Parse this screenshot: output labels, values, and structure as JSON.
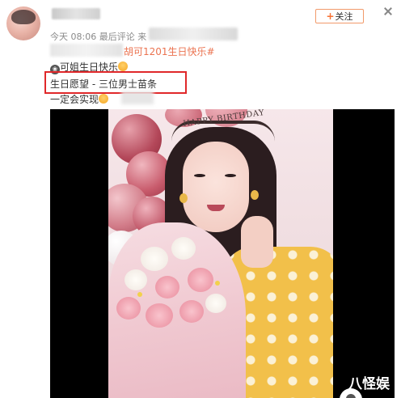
{
  "post": {
    "meta_text": "今天 08:06 最后评论 来",
    "follow_label": "关注",
    "follow_plus": "+",
    "hashtag": "胡可1201生日快乐#",
    "line1_text": "可姐生日快乐",
    "line2_text": "生日愿望 - 三位男士苗条",
    "line3_text": "一定会实现",
    "icons": [
      "avatar",
      "gift-icon",
      "smile-emoji-icon",
      "laugh-emoji-icon",
      "close-icon"
    ]
  },
  "video": {
    "headband_text": "HAPPY BIRTHDAY",
    "watermark_text": "八怪娱"
  },
  "colors": {
    "hashtag": "#eb7350",
    "highlight_border": "#e0282a",
    "follow_border": "#f19a6a",
    "sweater": "#f2c04a",
    "video_bg": "#000000"
  }
}
